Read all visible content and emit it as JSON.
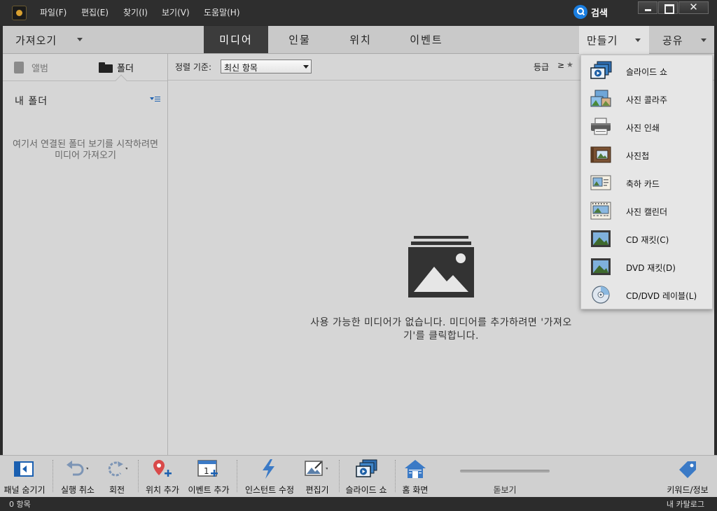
{
  "titlebar": {
    "menus": [
      "파일(F)",
      "편집(E)",
      "찾기(I)",
      "보기(V)",
      "도움말(H)"
    ],
    "search_label": "검색",
    "close_glyph": "✕"
  },
  "tabbar": {
    "import_label": "가져오기",
    "tabs": [
      "미디어",
      "인물",
      "위치",
      "이벤트"
    ],
    "active_tab": "미디어",
    "make_label": "만들기",
    "share_label": "공유"
  },
  "left_panel": {
    "album_tab": "앨범",
    "folder_tab": "폴더",
    "title": "내 폴더",
    "empty_message": "여기서 연결된 폴더 보기를 시작하려면미디어 가져오기"
  },
  "main": {
    "sort_label": "정렬 기준:",
    "sort_value": "최신 항목",
    "rating_label": "등급",
    "rating_operator": "≥",
    "rating_star": "★",
    "empty_message": "사용 가능한 미디어가 없습니다. 미디어를 추가하려면 '가져오기'를 클릭합니다."
  },
  "create_menu": {
    "items": [
      {
        "label": "슬라이드 쇼",
        "icon": "slideshow-icon"
      },
      {
        "label": "사진 콜라주",
        "icon": "photo-collage-icon"
      },
      {
        "label": "사진 인쇄",
        "icon": "printer-icon"
      },
      {
        "label": "사진첩",
        "icon": "photo-book-icon"
      },
      {
        "label": "축하 카드",
        "icon": "greeting-card-icon"
      },
      {
        "label": "사진 캘린더",
        "icon": "calendar-icon"
      },
      {
        "label": "CD 재킷(C)",
        "icon": "cd-jacket-icon"
      },
      {
        "label": "DVD 재킷(D)",
        "icon": "dvd-jacket-icon"
      },
      {
        "label": "CD/DVD 레이블(L)",
        "icon": "disc-label-icon"
      }
    ]
  },
  "toolbar": {
    "hide_panel": "패널 숨기기",
    "undo": "실행 취소",
    "rotate": "회전",
    "add_location": "위치 추가",
    "add_event": "이벤트 추가",
    "instant_fix": "인스턴트 수정",
    "editor": "편집기",
    "slideshow": "슬라이드 쇼",
    "home": "홈 화면",
    "zoom": "돋보기",
    "keywords": "키워드/정보",
    "event_badge": "1"
  },
  "status": {
    "item_count": "0 항목",
    "catalog": "내 카탈로그"
  },
  "colors": {
    "accent_blue": "#1a7ee0",
    "location_pin": "#d94a4a",
    "dark_chrome": "#2e2e2e",
    "panel_gray": "#d6d6d6"
  }
}
